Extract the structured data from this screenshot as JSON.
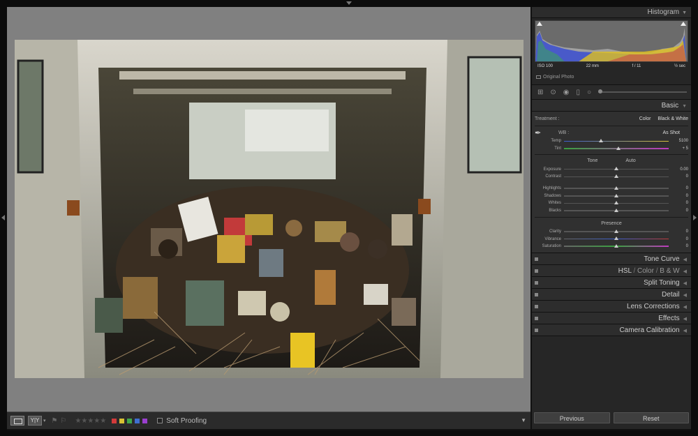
{
  "panel": {
    "histogram_title": "Histogram",
    "histogram_info": {
      "iso": "ISO 100",
      "focal": "22 mm",
      "aperture": "f / 11",
      "shutter": "½ sec"
    },
    "original_photo": "Original Photo",
    "basic": {
      "title": "Basic",
      "treatment_label": "Treatment :",
      "treatment_color": "Color",
      "treatment_bw": "Black & White",
      "wb_label": "WB :",
      "wb_value": "As Shot",
      "temp_label": "Temp",
      "temp_value": "5100",
      "tint_label": "Tint",
      "tint_value": "+ 5",
      "tone_label": "Tone",
      "tone_auto": "Auto",
      "exposure_label": "Exposure",
      "exposure_value": "0.00",
      "contrast_label": "Contrast",
      "contrast_value": "0",
      "highlights_label": "Highlights",
      "highlights_value": "0",
      "shadows_label": "Shadows",
      "shadows_value": "0",
      "whites_label": "Whites",
      "whites_value": "0",
      "blacks_label": "Blacks",
      "blacks_value": "0",
      "presence_label": "Presence",
      "clarity_label": "Clarity",
      "clarity_value": "0",
      "vibrance_label": "Vibrance",
      "vibrance_value": "0",
      "saturation_label": "Saturation",
      "saturation_value": "0"
    },
    "sections": {
      "tone_curve": "Tone Curve",
      "hsl": "HSL",
      "hsl_color": "Color",
      "hsl_bw": "B & W",
      "split_toning": "Split Toning",
      "detail": "Detail",
      "lens_corrections": "Lens Corrections",
      "effects": "Effects",
      "camera_calibration": "Camera Calibration"
    },
    "previous_button": "Previous",
    "reset_button": "Reset"
  },
  "toolbar": {
    "view_yy": "Y|Y",
    "soft_proofing": "Soft Proofing",
    "label_colors": [
      "#d23a3a",
      "#d8c233",
      "#3fa84a",
      "#3f6fd0",
      "#9a3fcf"
    ]
  },
  "icons": {
    "eyedropper": "eyedropper-icon",
    "crop": "crop-icon",
    "spot": "spot-removal-icon",
    "redeye": "red-eye-icon",
    "grad": "graduated-filter-icon",
    "radial": "radial-filter-icon"
  }
}
